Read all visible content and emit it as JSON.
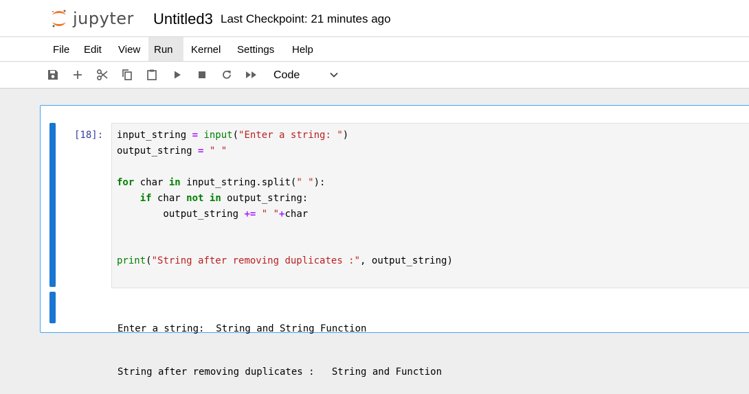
{
  "header": {
    "logo_text": "jupyter",
    "notebook_title": "Untitled3",
    "checkpoint_text": "Last Checkpoint: 21 minutes ago"
  },
  "menu": [
    "File",
    "Edit",
    "View",
    "Run",
    "Kernel",
    "Settings",
    "Help"
  ],
  "menu_active": "Run",
  "toolbar": {
    "icons": [
      "save-icon",
      "add-icon",
      "cut-icon",
      "copy-icon",
      "paste-icon",
      "run-icon",
      "stop-icon",
      "restart-icon",
      "fast-forward-icon"
    ],
    "cell_type": "Code"
  },
  "cell": {
    "prompt": "[18]:",
    "code_lines": [
      "input_string = input(\"Enter a string: \")",
      "output_string = \" \"",
      "",
      "for char in input_string.split(\" \"):",
      "    if char not in output_string:",
      "        output_string += \" \"+char",
      "",
      "",
      "print(\"String after removing duplicates :\", output_string)"
    ],
    "output_lines": [
      "Enter a string:  String and String Function",
      "String after removing duplicates :   String and Function"
    ]
  },
  "colors": {
    "accent_blue": "#1976d2",
    "logo_orange": "#f37626",
    "prompt_blue": "#303f9f",
    "keyword_green": "#008000",
    "string_red": "#ba2121",
    "operator_purple": "#aa22ff"
  }
}
